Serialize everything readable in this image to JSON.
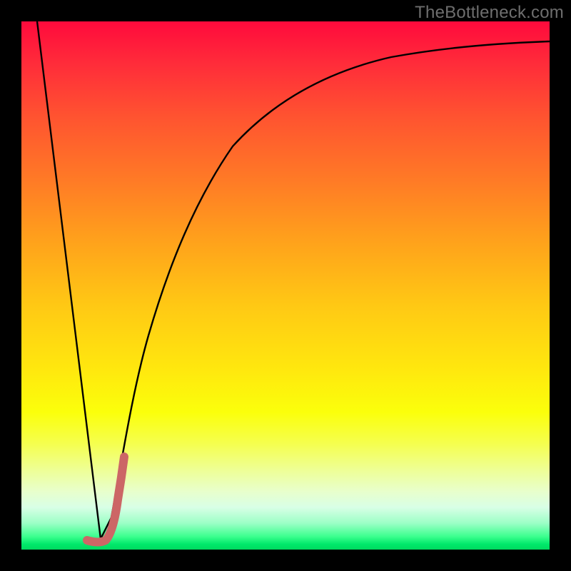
{
  "watermark": "TheBottleneck.com",
  "colors": {
    "background": "#000000",
    "gradient_top": "#FF0A3C",
    "gradient_mid": "#FFE80E",
    "gradient_bottom": "#00D85F",
    "curve": "#000000",
    "highlight": "#CC6666"
  },
  "chart_data": {
    "type": "line",
    "title": "",
    "xlabel": "",
    "ylabel": "",
    "xlim": [
      0,
      100
    ],
    "ylim": [
      0,
      100
    ],
    "series": [
      {
        "name": "black-curve",
        "x": [
          3,
          15,
          17,
          19,
          21,
          24,
          28,
          33,
          40,
          50,
          62,
          75,
          88,
          100
        ],
        "y": [
          100,
          2,
          6,
          15,
          25,
          40,
          55,
          67,
          77,
          84,
          89,
          92,
          94,
          95
        ]
      },
      {
        "name": "red-highlight",
        "x": [
          12.5,
          15.5,
          17.0,
          18.2,
          19.5
        ],
        "y": [
          1.8,
          1.5,
          4.0,
          10.0,
          18.0
        ]
      }
    ]
  }
}
